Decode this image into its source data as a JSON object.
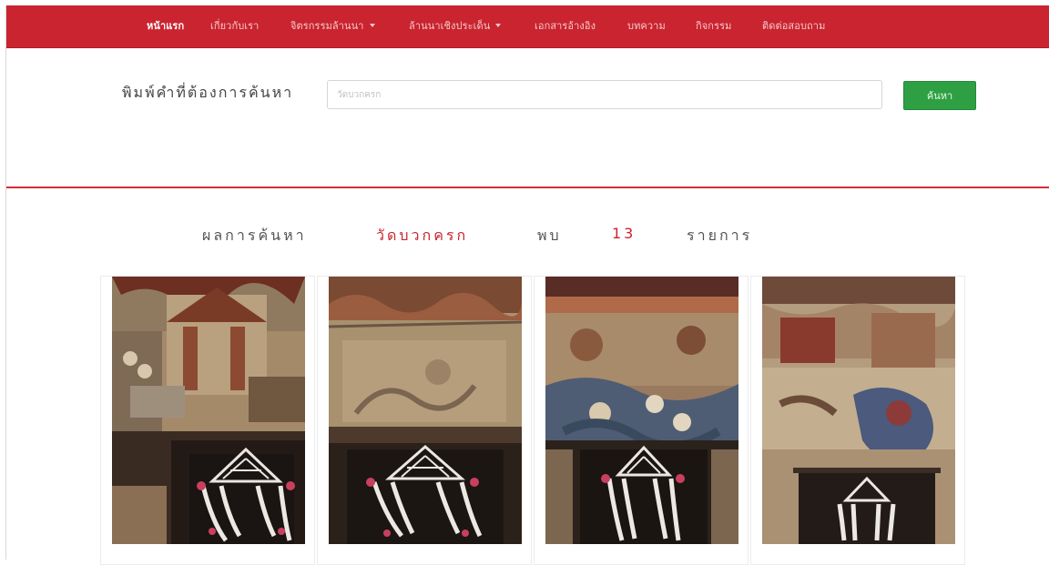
{
  "nav": {
    "items": [
      {
        "label": "หน้าแรก",
        "active": true,
        "dropdown": false
      },
      {
        "label": "เกี่ยวกับเรา",
        "active": false,
        "dropdown": false
      },
      {
        "label": "จิตรกรรมล้านนา",
        "active": false,
        "dropdown": true
      },
      {
        "label": "ล้านนาเชิงประเด็น",
        "active": false,
        "dropdown": true
      },
      {
        "label": "เอกสารอ้างอิง",
        "active": false,
        "dropdown": false
      },
      {
        "label": "บทความ",
        "active": false,
        "dropdown": false
      },
      {
        "label": "กิจกรรม",
        "active": false,
        "dropdown": false
      },
      {
        "label": "ติดต่อสอบถาม",
        "active": false,
        "dropdown": false
      }
    ]
  },
  "search": {
    "label": "พิมพ์คำที่ต้องการค้นหา",
    "placeholder": "วัดบวกครก",
    "value": "",
    "button": "ค้นหา"
  },
  "results": {
    "prefix": "ผลการค้นหา",
    "term": "วัดบวกครก",
    "found_label": "พบ",
    "count": "13",
    "unit": "รายการ"
  },
  "cards": [
    {
      "image": "mural-photo"
    },
    {
      "image": "mural-photo"
    },
    {
      "image": "mural-photo"
    },
    {
      "image": "mural-photo"
    }
  ],
  "colors": {
    "navbar": "#c9242f",
    "accent": "#c9242f",
    "button": "#2ea043"
  }
}
